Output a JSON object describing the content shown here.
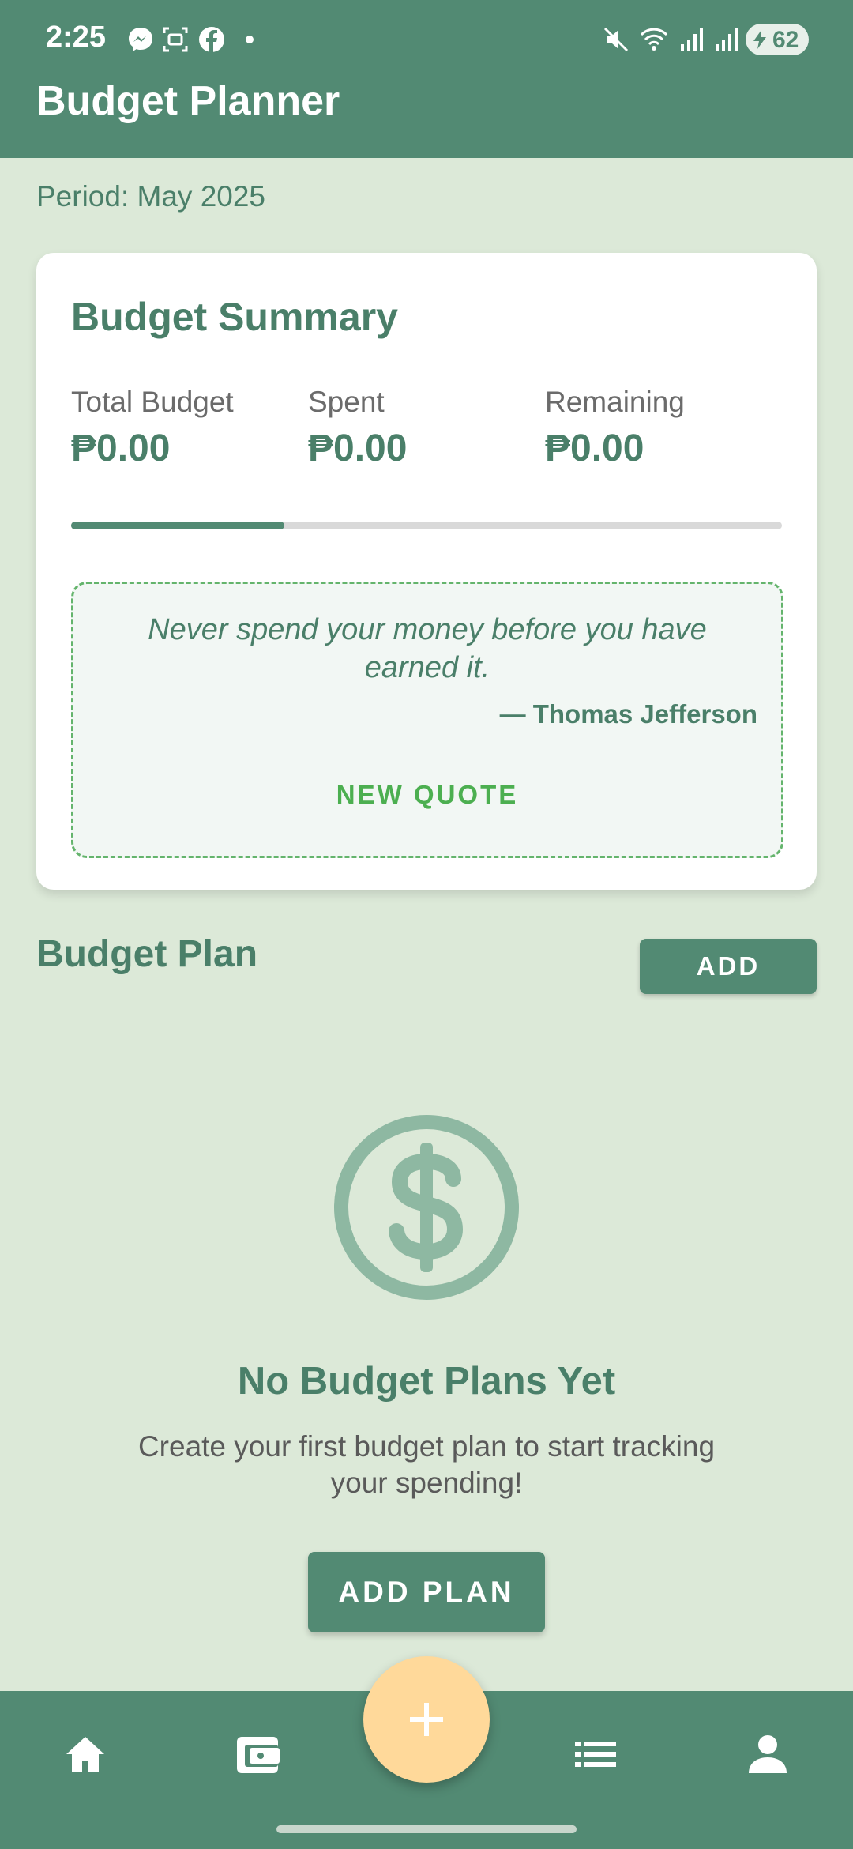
{
  "status_bar": {
    "time": "2:25",
    "battery": "62",
    "icons": [
      "messenger-icon",
      "screenshot-icon",
      "facebook-icon",
      "dot-icon",
      "mute-icon",
      "wifi-icon",
      "signal-icon",
      "signal-icon",
      "battery-icon"
    ]
  },
  "app_bar": {
    "title": "Budget Planner"
  },
  "period_label": "Period: May 2025",
  "summary": {
    "title": "Budget Summary",
    "metrics": [
      {
        "label": "Total Budget",
        "value": "₱0.00"
      },
      {
        "label": "Spent",
        "value": "₱0.00"
      },
      {
        "label": "Remaining",
        "value": "₱0.00"
      }
    ],
    "progress_fraction": 0.3
  },
  "quote": {
    "text": "Never spend your money before you have earned it.",
    "author": "— Thomas Jefferson",
    "button": "NEW QUOTE"
  },
  "plans": {
    "title": "Budget Plan",
    "add_label": "ADD",
    "empty_icon": "dollar-circle-icon",
    "empty_title": "No Budget Plans Yet",
    "empty_subtitle": "Create your first budget plan to start tracking your spending!",
    "add_plan_label": "ADD PLAN"
  },
  "bottom_nav": {
    "items": [
      "home-icon",
      "wallet-icon",
      "add-icon",
      "list-icon",
      "profile-icon"
    ],
    "fab_color": "#ffd99a"
  },
  "colors": {
    "primary": "#528a73",
    "background": "#dce9d8",
    "accent_green": "#4caf50"
  }
}
